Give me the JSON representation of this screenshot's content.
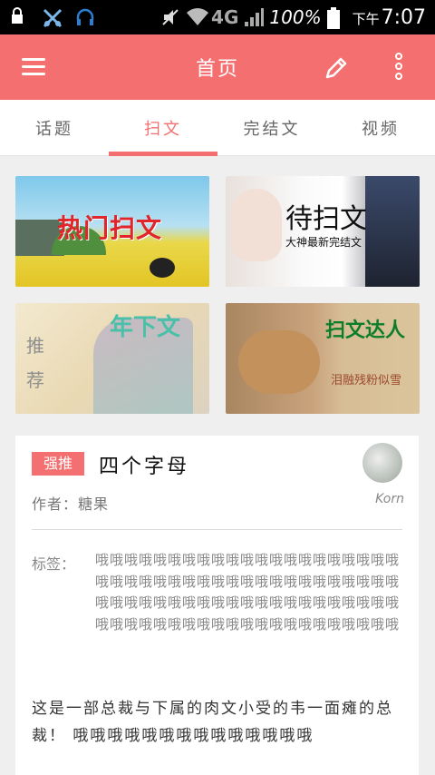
{
  "status_bar": {
    "network": "4G",
    "battery": "100%",
    "time_prefix": "下午",
    "time": "7:07"
  },
  "app_bar": {
    "title": "首页"
  },
  "tabs": [
    {
      "label": "话题"
    },
    {
      "label": "扫文"
    },
    {
      "label": "完结文"
    },
    {
      "label": "视频"
    }
  ],
  "banners": [
    {
      "title": "热门扫文"
    },
    {
      "title": "待扫文",
      "subtitle": "大神最新完结文"
    },
    {
      "title": "年下文",
      "side_label": "推荐"
    },
    {
      "title": "扫文达人",
      "subtitle": "泪融残粉似雪"
    }
  ],
  "card": {
    "badge": "强推",
    "title": "四个字母",
    "author": "作者：糖果",
    "username": "Korn",
    "tags_label": "标签：",
    "tags": "哦哦哦哦哦哦哦哦哦哦哦哦哦哦哦哦哦哦哦哦哦哦哦哦哦哦哦哦哦哦哦哦哦哦哦哦哦哦哦哦哦哦哦哦哦哦哦哦哦哦哦哦哦哦哦哦哦哦哦哦哦哦哦哦哦哦哦哦哦哦哦哦哦哦哦哦哦哦哦哦哦哦哦哦",
    "description": "这是一部总裁与下属的肉文小受的韦一面瘫的总裁！ 哦哦哦哦哦哦哦哦哦哦哦哦哦哦"
  }
}
